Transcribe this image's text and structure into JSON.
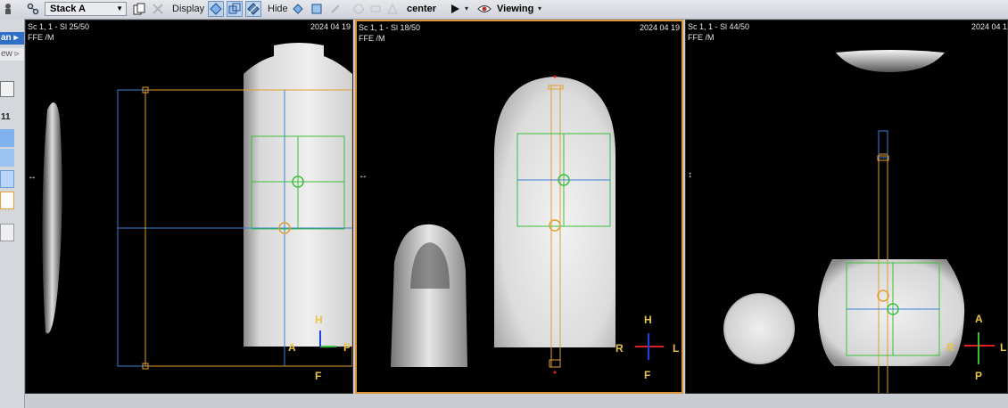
{
  "toolbar": {
    "stack_label": "Stack A",
    "display_label": "Display",
    "hide_label": "Hide",
    "center_label": "center",
    "viewing_label": "Viewing"
  },
  "leftstrip": {
    "tab1": "an",
    "tab2": "ew",
    "count": "11"
  },
  "viewports": [
    {
      "series": "Sc 1, 1 - Sl 25/50",
      "date": "2024 04 19",
      "protocol": "FFE  /M",
      "orientation": {
        "top": "H",
        "bottom": "F",
        "left": "A",
        "right": "P"
      }
    },
    {
      "series": "Sc 1, 1 - Sl 18/50",
      "date": "2024 04 19",
      "protocol": "FFE  /M",
      "orientation": {
        "top": "H",
        "bottom": "F",
        "left": "R",
        "right": "L"
      }
    },
    {
      "series": "Sc 1, 1 - Sl 44/50",
      "date": "2024 04 1",
      "protocol": "FFE  /M",
      "orientation": {
        "top": "A",
        "bottom": "P",
        "left": "R",
        "right": "L"
      }
    }
  ],
  "colors": {
    "active_border": "#d9953a",
    "stack_blue": "#3d7fd6",
    "stack_orange": "#e0a030",
    "stack_green": "#3bbf3b",
    "axis_red": "#e02020"
  }
}
